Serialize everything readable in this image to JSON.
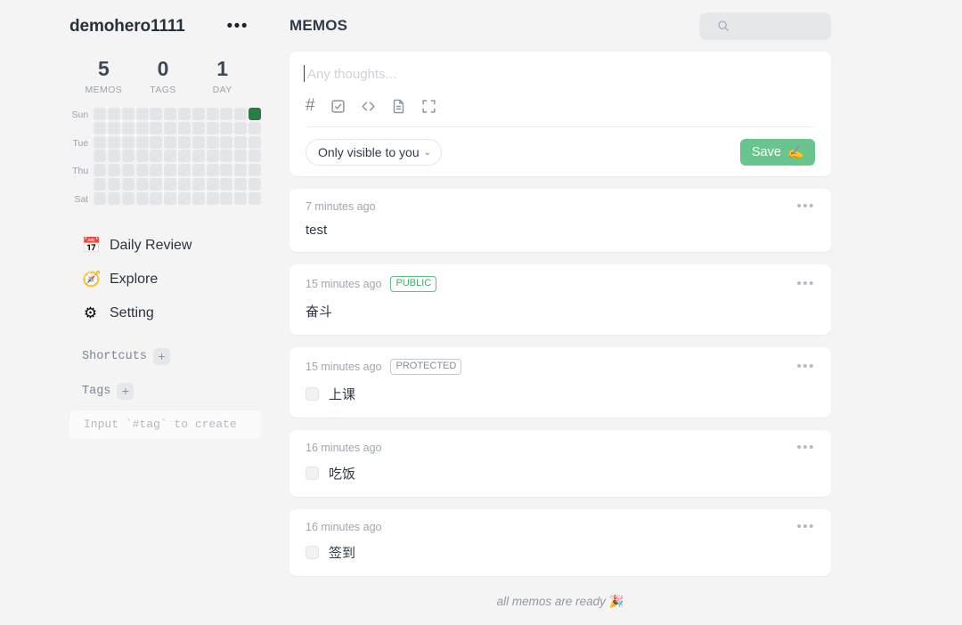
{
  "sidebar": {
    "username": "demohero1111",
    "more_icon": "•••",
    "stats": [
      {
        "value": "5",
        "label": "MEMOS"
      },
      {
        "value": "0",
        "label": "TAGS"
      },
      {
        "value": "1",
        "label": "DAY"
      }
    ],
    "heatmap": {
      "day_labels": [
        "Sun",
        "",
        "Tue",
        "",
        "Thu",
        "",
        "Sat"
      ],
      "columns": 12,
      "rows": 7,
      "active_cells": [
        [
          0,
          11
        ]
      ],
      "empty_color": "#e3e5e9",
      "active_color": "#24803f"
    },
    "nav": [
      {
        "icon": "📅",
        "icon_name": "calendar-icon",
        "label": "Daily Review"
      },
      {
        "icon": "🧭",
        "icon_name": "compass-icon",
        "label": "Explore"
      },
      {
        "icon": "⚙",
        "icon_name": "gear-icon",
        "label": "Setting"
      }
    ],
    "shortcuts": {
      "label": "Shortcuts",
      "add": "+"
    },
    "tags": {
      "label": "Tags",
      "add": "+"
    },
    "tag_input_placeholder": "Input `#tag` to create"
  },
  "header": {
    "title": "MEMOS",
    "search_placeholder": ""
  },
  "editor": {
    "placeholder": "Any thoughts...",
    "tools": [
      {
        "name": "hash-icon",
        "glyph": "#"
      },
      {
        "name": "checkbox-icon"
      },
      {
        "name": "code-icon"
      },
      {
        "name": "document-icon"
      },
      {
        "name": "fullscreen-icon"
      }
    ],
    "visibility": "Only visible to you",
    "visibility_chevron": "⌄",
    "save_label": "Save",
    "save_emoji": "✍️",
    "save_color": "#6ac48d"
  },
  "memos": [
    {
      "time": "7 minutes ago",
      "badge": null,
      "checkbox": false,
      "text": "test",
      "dots": "•••"
    },
    {
      "time": "15 minutes ago",
      "badge": "PUBLIC",
      "checkbox": false,
      "text": "奋斗",
      "dots": "•••"
    },
    {
      "time": "15 minutes ago",
      "badge": "PROTECTED",
      "checkbox": true,
      "text": "上课",
      "dots": "•••"
    },
    {
      "time": "16 minutes ago",
      "badge": null,
      "checkbox": true,
      "text": "吃饭",
      "dots": "•••"
    },
    {
      "time": "16 minutes ago",
      "badge": null,
      "checkbox": true,
      "text": "签到",
      "dots": "•••"
    }
  ],
  "footer": {
    "text": "all memos are ready ",
    "emoji": "🎉"
  }
}
